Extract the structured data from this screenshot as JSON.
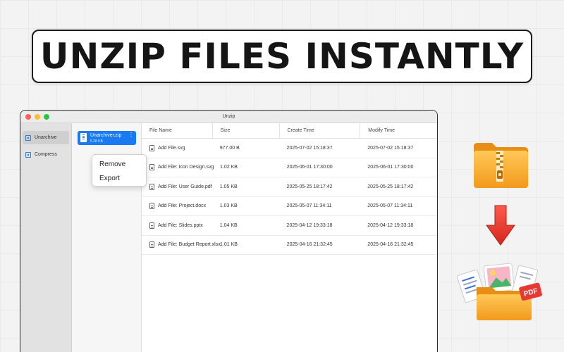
{
  "headline": "UNZIP FILES INSTANTLY",
  "window": {
    "title": "Unzip"
  },
  "sidebar": {
    "items": [
      {
        "label": "Unarchive",
        "active": true
      },
      {
        "label": "Compress",
        "active": false
      }
    ]
  },
  "archive": {
    "name": "Unarchiver.zip",
    "size": "5.28 KB",
    "more": "⋮"
  },
  "context_menu": {
    "items": [
      "Remove",
      "Export"
    ]
  },
  "table": {
    "columns": [
      "File Name",
      "Size",
      "Create Time",
      "Modify Time"
    ],
    "rows": [
      {
        "name": "Add File.svg",
        "size": "977.00 B",
        "create": "2025-07-02 15:18:37",
        "modify": "2025-07-02 15:18:37"
      },
      {
        "name": "Add File: Icon Design.svg",
        "size": "1.02 KB",
        "create": "2025-06-01 17:30:00",
        "modify": "2025-06-01 17:30:00"
      },
      {
        "name": "Add File: User Guide.pdf",
        "size": "1.05 KB",
        "create": "2025-05-25 18:17:42",
        "modify": "2025-05-25 18:17:42"
      },
      {
        "name": "Add File: Project.docx",
        "size": "1.03 KB",
        "create": "2025-05-07 11:34:11",
        "modify": "2025-05-07 11:34:11"
      },
      {
        "name": "Add File: Slides.pptx",
        "size": "1.04 KB",
        "create": "2025-04-12 19:33:18",
        "modify": "2025-04-12 19:33:18"
      },
      {
        "name": "Add File: Budget Report.xlsx",
        "size": "1.01 KB",
        "create": "2025-04-16 21:32:45",
        "modify": "2025-04-16 21:32:45"
      }
    ]
  },
  "illustrations": {
    "pdf_label": "PDF",
    "icons": [
      "zip-folder-icon",
      "down-arrow-icon",
      "files-folder-icon"
    ]
  },
  "colors": {
    "accent": "#1a7af0",
    "folder": "#f5a623",
    "arrow": "#e53935"
  }
}
